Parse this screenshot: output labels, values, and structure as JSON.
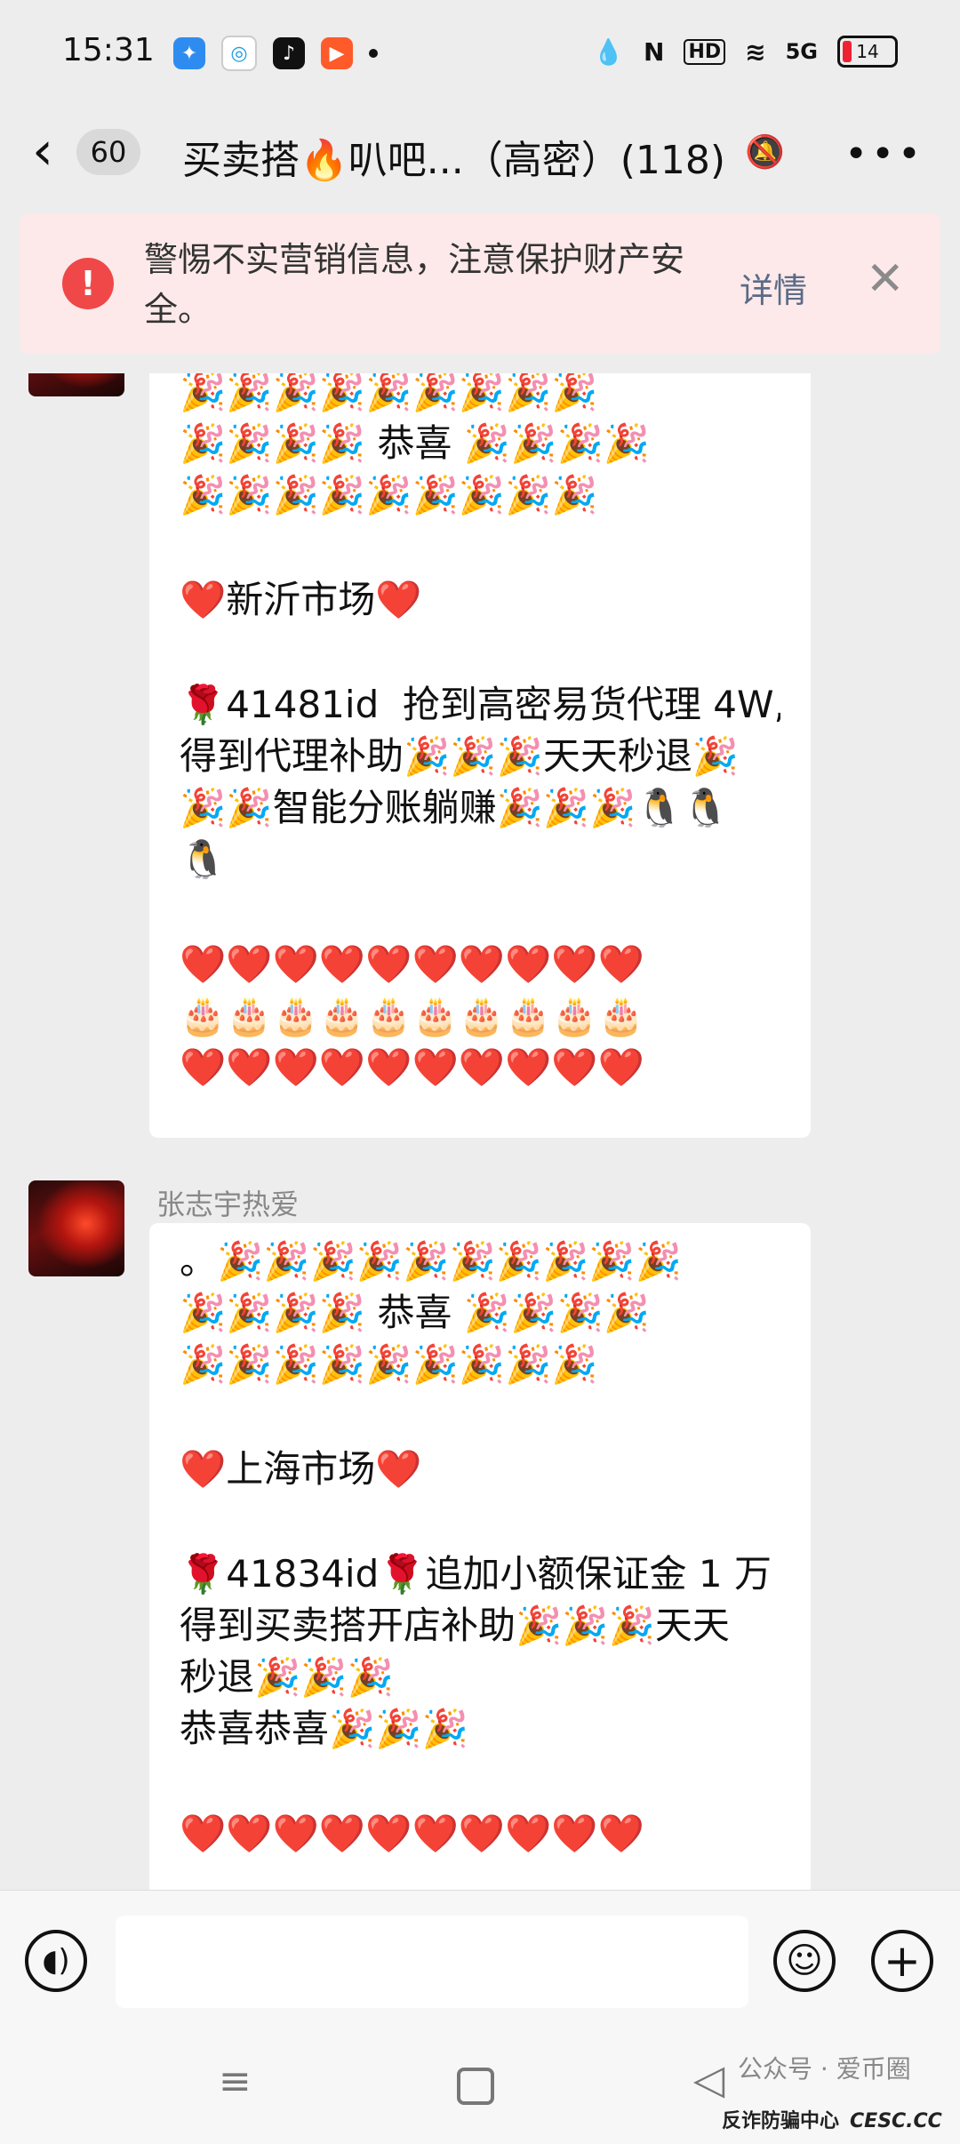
{
  "status_bar": {
    "time": "15:31",
    "network": "5G",
    "hd": "HD",
    "nfc": "N",
    "battery": "14",
    "app_icons": [
      "messenger-icon",
      "china-mobile-icon",
      "tiktok-icon",
      "video-icon"
    ]
  },
  "header": {
    "unread_count": "60",
    "title": "买卖搭🔥叭吧...（高密）(118)",
    "more": "•••"
  },
  "warning": {
    "icon": "!",
    "text": "警惕不实营销信息，注意保护财产安全。",
    "detail_label": "详情",
    "close": "✕"
  },
  "messages": [
    {
      "sender": "",
      "lines": [
        "🎉🎉🎉🎉🎉🎉🎉🎉🎉",
        "🎉🎉🎉🎉 恭喜 🎉🎉🎉🎉",
        "🎉🎉🎉🎉🎉🎉🎉🎉🎉",
        "",
        "❤️新沂市场❤️",
        "",
        "🌹41481id  抢到高密易货代理 4W,",
        "得到代理补助🎉🎉🎉天天秒退🎉",
        "🎉🎉智能分账躺赚🎉🎉🎉🐧🐧",
        "🐧",
        "",
        "❤️❤️❤️❤️❤️❤️❤️❤️❤️❤️",
        "🎂🎂🎂🎂🎂🎂🎂🎂🎂🎂",
        "❤️❤️❤️❤️❤️❤️❤️❤️❤️❤️"
      ]
    },
    {
      "sender": "张志宇热爱",
      "lines": [
        "。🎉🎉🎉🎉🎉🎉🎉🎉🎉🎉",
        "🎉🎉🎉🎉 恭喜 🎉🎉🎉🎉",
        "🎉🎉🎉🎉🎉🎉🎉🎉🎉",
        "",
        "❤️上海市场❤️",
        "",
        "🌹41834id🌹追加小额保证金 1 万",
        "得到买卖搭开店补助🎉🎉🎉天天",
        "秒退🎉🎉🎉",
        "恭喜恭喜🎉🎉🎉",
        "",
        "❤️❤️❤️❤️❤️❤️❤️❤️❤️❤️"
      ]
    }
  ],
  "input": {
    "value": "",
    "placeholder": ""
  },
  "watermark": {
    "line1": "公众号 · 爱币圈",
    "line2": "反诈防骗中心",
    "line3": "CESC.CC"
  }
}
